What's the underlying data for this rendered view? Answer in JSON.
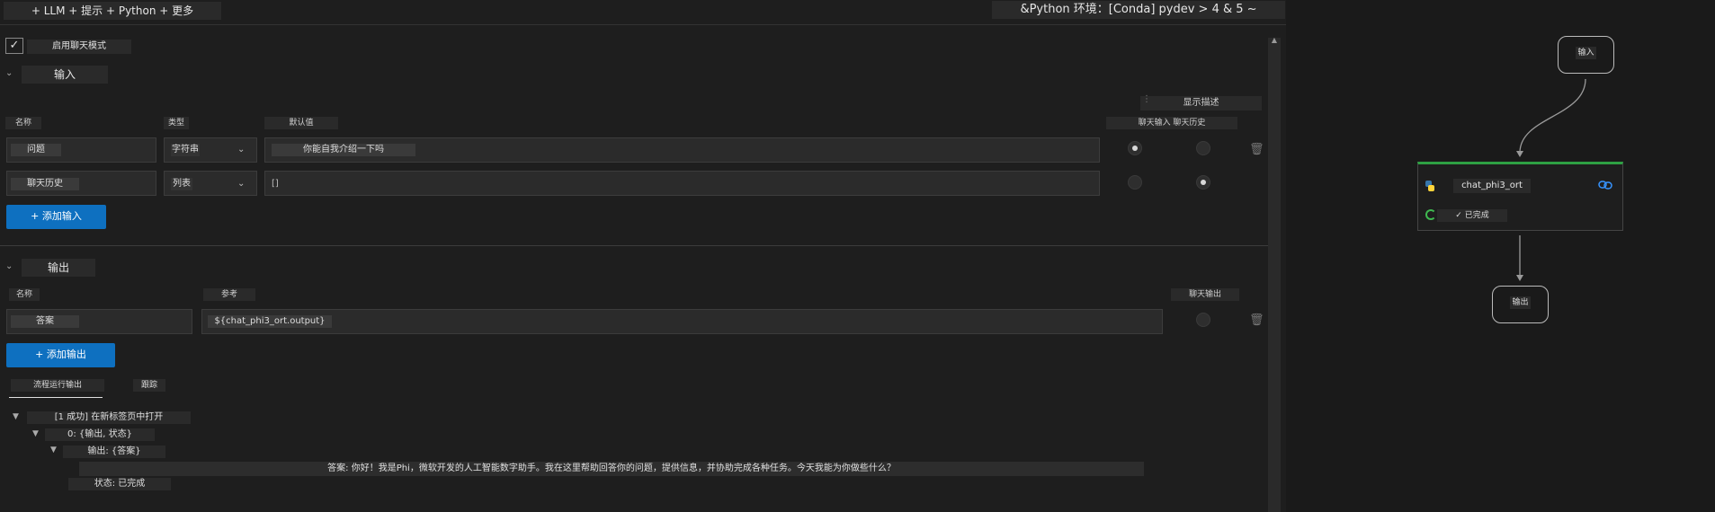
{
  "topbar": {
    "left_title": "+ LLM + 提示 + Python + 更多",
    "right_title": "&Python 环境：[Conda] pydev > 4 & 5 ~"
  },
  "chat_mode": {
    "checked": true,
    "label": "启用聊天模式"
  },
  "inputs": {
    "title": "输入",
    "show_description": "显示描述",
    "headers": {
      "name": "名称",
      "type": "类型",
      "default": "默认值",
      "chat_io": "聊天输入 聊天历史"
    },
    "rows": [
      {
        "name": "问题",
        "type": "字符串",
        "default": "你能自我介绍一下吗",
        "chat_input": true,
        "chat_history": false
      },
      {
        "name": "聊天历史",
        "type": "列表",
        "default": "[]",
        "chat_input": false,
        "chat_history": true
      }
    ],
    "add_button": "+ 添加输入"
  },
  "outputs": {
    "title": "输出",
    "headers": {
      "name": "名称",
      "reference": "参考",
      "chat_output": "聊天输出"
    },
    "rows": [
      {
        "name": "答案",
        "reference": "${chat_phi3_ort.output}",
        "chat_output": false
      }
    ],
    "add_button": "+ 添加输出"
  },
  "run_tabs": {
    "active": "流程运行输出",
    "other": "跟踪"
  },
  "tree": {
    "root": "[1 成功] 在新标签页中打开",
    "item0": "0: {输出, 状态}",
    "output": "输出: {答案}",
    "answer": "答案: 你好！我是Phi，微软开发的人工智能数字助手。我在这里帮助回答你的问题，提供信息，并协助完成各种任务。今天我能为你做些什么？",
    "status": "状态: 已完成"
  },
  "graph": {
    "input_node": "输入",
    "main_node": {
      "title": "chat_phi3_ort",
      "status": "✓ 已完成",
      "status_color": "#3fb950",
      "top_color": "#2ea043"
    },
    "output_node": "输出"
  },
  "colors": {
    "accent": "#0e70c0",
    "background": "#1e1e1e"
  }
}
